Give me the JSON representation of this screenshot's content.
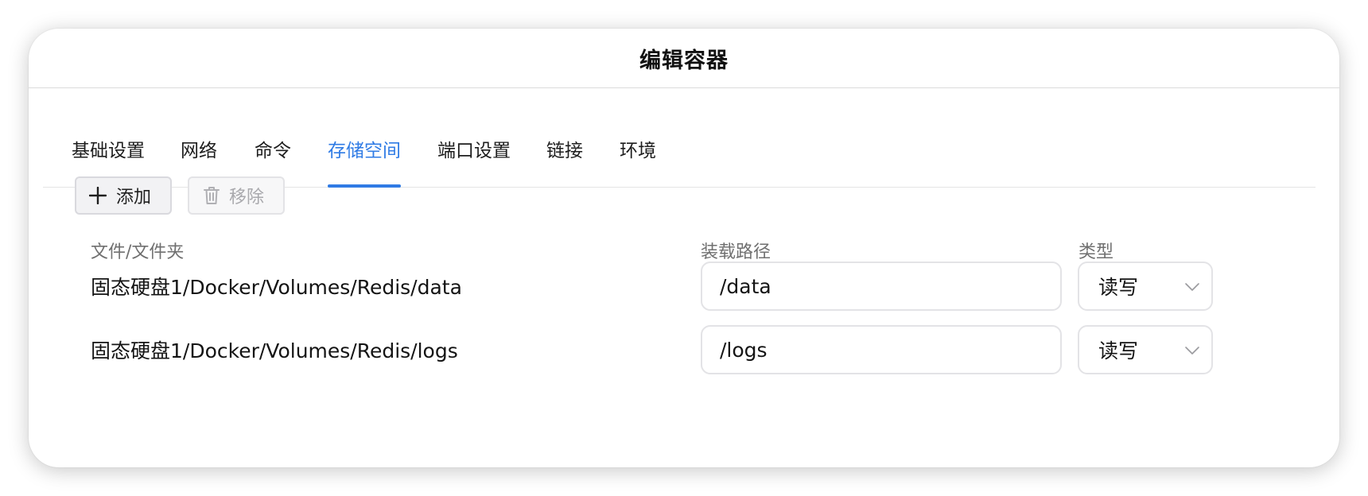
{
  "dialog": {
    "title": "编辑容器"
  },
  "tabs": [
    {
      "label": "基础设置",
      "active": false
    },
    {
      "label": "网络",
      "active": false
    },
    {
      "label": "命令",
      "active": false
    },
    {
      "label": "存储空间",
      "active": true
    },
    {
      "label": "端口设置",
      "active": false
    },
    {
      "label": "链接",
      "active": false
    },
    {
      "label": "环境",
      "active": false
    }
  ],
  "toolbar": {
    "add_label": "添加",
    "remove_label": "移除",
    "remove_disabled": true
  },
  "table": {
    "headers": {
      "file": "文件/文件夹",
      "mount": "装载路径",
      "type": "类型"
    },
    "rows": [
      {
        "path": "固态硬盘1/Docker/Volumes/Redis/data",
        "mount": "/data",
        "type": "读写"
      },
      {
        "path": "固态硬盘1/Docker/Volumes/Redis/logs",
        "mount": "/logs",
        "type": "读写"
      }
    ]
  },
  "colors": {
    "accent": "#2f7be5",
    "text": "#141414",
    "muted": "#707070",
    "border": "#e3e3e6"
  },
  "icons": {
    "add": "plus-icon",
    "remove": "trash-icon",
    "select": "chevron-down-icon"
  }
}
